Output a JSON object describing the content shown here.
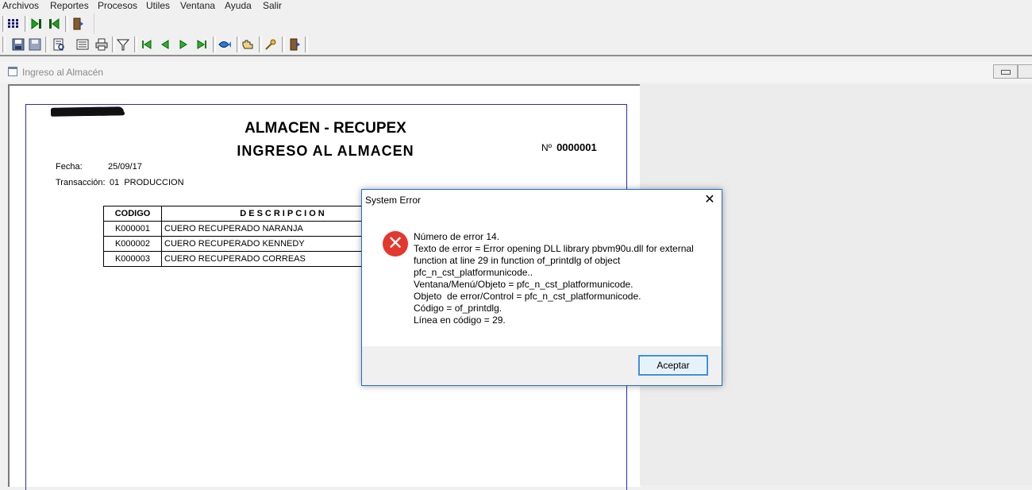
{
  "menu": [
    "Archivos",
    "Reportes",
    "Procesos",
    "Utiles",
    "Ventana",
    "Ayuda",
    "Salir"
  ],
  "toolbar": {
    "row1": [
      "grid-icon",
      "forward-icon",
      "back-icon",
      "exit-icon"
    ],
    "row2": [
      "save-icon",
      "save-all-icon",
      "preview-icon",
      "print-setup-icon",
      "print-icon",
      "filter-icon",
      "first-icon",
      "previous-icon",
      "next-icon",
      "last-icon",
      "fish-icon",
      "hand-icon",
      "key-icon",
      "exit-icon"
    ]
  },
  "child_window": {
    "title": "Ingreso al Almacén"
  },
  "report": {
    "title": "ALMACEN - RECUPEX",
    "subtitle": "INGRESO AL ALMACEN",
    "numero_label": "Nº",
    "numero_value": "0000001",
    "fecha_label": "Fecha:",
    "fecha_value": "25/09/17",
    "transaccion_label": "Transacción:",
    "transaccion_value": "01  PRODUCCION",
    "columns": [
      "CODIGO",
      "DESCRIPCION"
    ],
    "rows": [
      {
        "codigo": "K000001",
        "descripcion": "CUERO RECUPERADO NARANJA"
      },
      {
        "codigo": "K000002",
        "descripcion": "CUERO RECUPERADO KENNEDY"
      },
      {
        "codigo": "K000003",
        "descripcion": "CUERO RECUPERADO CORREAS"
      }
    ]
  },
  "dialog": {
    "title": "System Error",
    "close": "✕",
    "lines": [
      "Número de error 14.",
      "Texto de error = Error opening DLL library pbvm90u.dll for external",
      "function at line 29 in function of_printdlg of object",
      "pfc_n_cst_platformunicode..",
      "Ventana/Menú/Objeto = pfc_n_cst_platformunicode.",
      "Objeto  de error/Control = pfc_n_cst_platformunicode.",
      "Código = of_printdlg.",
      "Línea en código = 29."
    ],
    "ok_label": "Aceptar"
  }
}
